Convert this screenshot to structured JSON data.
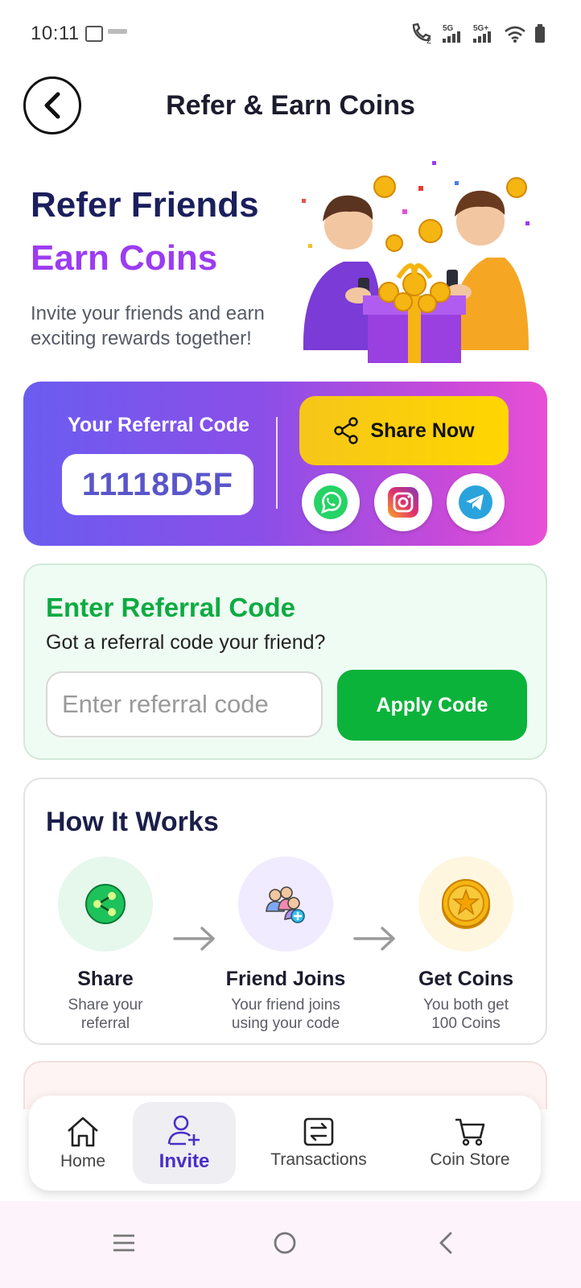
{
  "status_bar": {
    "time": "10:11",
    "network_1": "5G",
    "network_2": "5G+",
    "sim_slot": "2"
  },
  "header": {
    "title": "Refer & Earn Coins",
    "back_icon": "chevron-left-icon"
  },
  "hero": {
    "title_line_1": "Refer Friends",
    "title_line_2": "Earn Coins",
    "subtitle": "Invite your friends and earn exciting rewards together!",
    "title_color": "#1b1f5c",
    "accent_color": "#9b3cf2"
  },
  "referral_card": {
    "label": "Your Referral Code",
    "code": "11118D5F",
    "share_button_label": "Share Now",
    "social": [
      "whatsapp-icon",
      "instagram-icon",
      "telegram-icon"
    ]
  },
  "enter_referral": {
    "title": "Enter Referral Code",
    "subtitle": "Got a referral code your friend?",
    "input_placeholder": "Enter referral code",
    "input_value": "",
    "apply_label": "Apply Code",
    "accent_color": "#0dab42"
  },
  "how_it_works": {
    "title": "How It Works",
    "steps": [
      {
        "title": "Share",
        "desc": "Share your referral",
        "icon": "share-icon"
      },
      {
        "title": "Friend Joins",
        "desc": "Your friend joins using your code",
        "icon": "add-friends-icon"
      },
      {
        "title": "Get Coins",
        "desc": "You both get 100 Coins",
        "icon": "coin-icon"
      }
    ]
  },
  "bottom_nav": {
    "items": [
      {
        "label": "Home",
        "icon": "home-icon",
        "active": false
      },
      {
        "label": "Invite",
        "icon": "add-user-icon",
        "active": true
      },
      {
        "label": "Transactions",
        "icon": "transactions-icon",
        "active": false
      },
      {
        "label": "Coin Store",
        "icon": "cart-icon",
        "active": false
      }
    ],
    "active_color": "#4a2fc7"
  }
}
